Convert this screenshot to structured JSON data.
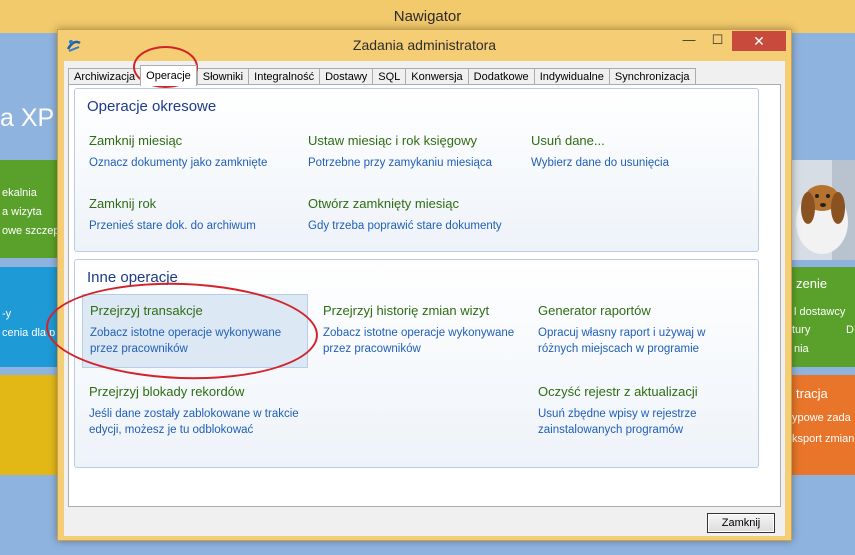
{
  "background_window": {
    "title": "Nawigator",
    "brand_fragment": "a XP",
    "left_tiles": {
      "green": [
        "ekalnia",
        "a wizyta",
        "owe szczep"
      ],
      "blue": [
        "-y",
        "cenia dla p"
      ]
    },
    "right_tiles": {
      "green": [
        "zenie",
        "l dostawcy",
        "tury",
        "D",
        "nia"
      ],
      "orange": [
        "tracja",
        "ypowe zada",
        "ksport zmian"
      ]
    }
  },
  "dialog": {
    "title": "Zadania administratora",
    "window_buttons": {
      "minimize": "—",
      "maximize": "☐",
      "close": "✕"
    },
    "tabs": [
      {
        "label": "Archiwizacja",
        "active": false
      },
      {
        "label": "Operacje",
        "active": true
      },
      {
        "label": "Słowniki",
        "active": false
      },
      {
        "label": "Integralność",
        "active": false
      },
      {
        "label": "Dostawy",
        "active": false
      },
      {
        "label": "SQL",
        "active": false
      },
      {
        "label": "Konwersja",
        "active": false
      },
      {
        "label": "Dodatkowe",
        "active": false
      },
      {
        "label": "Indywidualne",
        "active": false
      },
      {
        "label": "Synchronizacja",
        "active": false
      }
    ],
    "periodic": {
      "title": "Operacje okresowe",
      "ops": [
        {
          "title": "Zamknij miesiąc",
          "desc": "Oznacz dokumenty jako zamknięte"
        },
        {
          "title": "Ustaw miesiąc i rok księgowy",
          "desc": "Potrzebne przy zamykaniu miesiąca"
        },
        {
          "title": "Usuń dane...",
          "desc": "Wybierz dane do usunięcia"
        },
        {
          "title": "Zamknij rok",
          "desc": "Przenieś stare dok. do archiwum"
        },
        {
          "title": "Otwórz zamknięty miesiąc",
          "desc": "Gdy trzeba poprawić stare dokumenty"
        }
      ]
    },
    "other": {
      "title": "Inne operacje",
      "ops": [
        {
          "title": "Przejrzyj transakcje",
          "desc": "Zobacz istotne operacje wykonywane przez pracowników"
        },
        {
          "title": "Przejrzyj historię zmian wizyt",
          "desc": "Zobacz istotne operacje wykonywane przez pracowników"
        },
        {
          "title": "Generator raportów",
          "desc": "Opracuj własny raport i używaj w różnych miejscach w programie"
        },
        {
          "title": "Przejrzyj blokady rekordów",
          "desc": "Jeśli dane zostały zablokowane w trakcie edycji, możesz je tu odblokować"
        },
        {
          "title": "Oczyść rejestr z aktualizacji",
          "desc": "Usuń zbędne wpisy w rejestrze zainstalowanych programów"
        }
      ]
    },
    "close_button": "Zamknij"
  },
  "colors": {
    "titlebar": "#f5cd74",
    "close_red": "#c74a3c",
    "op_title_green": "#2e6d14",
    "op_desc_blue": "#1f5fb8",
    "group_title_blue": "#1e3a8a",
    "annotation_red": "#d2232a"
  }
}
